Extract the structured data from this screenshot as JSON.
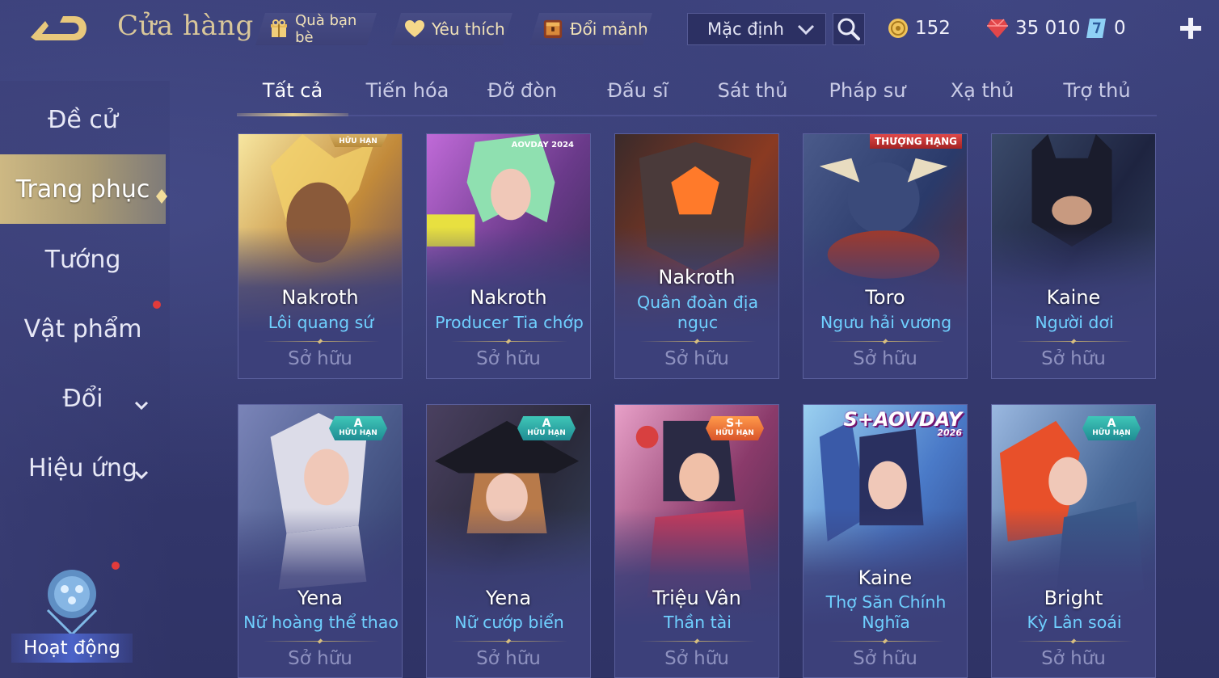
{
  "header": {
    "title": "Cửa hàng",
    "tabs": [
      {
        "label": "Quà bạn bè",
        "icon": "gift-icon"
      },
      {
        "label": "Yêu thích",
        "icon": "heart-icon"
      },
      {
        "label": "Đổi mảnh",
        "icon": "shard-chest-icon"
      }
    ],
    "sort": {
      "value": "Mặc định"
    },
    "currencies": [
      {
        "icon": "gold-coin-icon",
        "value": "152"
      },
      {
        "icon": "ruby-gem-icon",
        "value": "35 010"
      },
      {
        "icon": "voucher-icon",
        "value": "0"
      }
    ]
  },
  "sidebar": {
    "items": [
      {
        "label": "Đề cử"
      },
      {
        "label": "Trang phục"
      },
      {
        "label": "Tướng"
      },
      {
        "label": "Vật phẩm"
      },
      {
        "label": "Đổi"
      },
      {
        "label": "Hiệu ứng"
      }
    ],
    "activity_label": "Hoạt động"
  },
  "categories": [
    "Tất cả",
    "Tiến hóa",
    "Đỡ đòn",
    "Đấu sĩ",
    "Sát thủ",
    "Pháp sư",
    "Xạ thủ",
    "Trợ thủ"
  ],
  "cards": [
    {
      "hero": "Nakroth",
      "skin": "Lôi quang sứ",
      "status": "Sở hữu",
      "badge_title": "HỮU HẠN"
    },
    {
      "hero": "Nakroth",
      "skin": "Producer Tia chớp",
      "status": "Sở hữu",
      "badge_title": "AOVDAY 2024"
    },
    {
      "hero": "Nakroth",
      "skin": "Quân đoàn địa ngục",
      "status": "Sở hữu"
    },
    {
      "hero": "Toro",
      "skin": "Ngưu hải vương",
      "status": "Sở hữu",
      "ribbon": "THƯỢNG HẠNG"
    },
    {
      "hero": "Kaine",
      "skin": "Người dơi",
      "status": "Sở hữu"
    },
    {
      "hero": "Yena",
      "skin": "Nữ hoàng thể thao",
      "status": "Sở hữu",
      "grade": "A",
      "badge_title": "HỮU HẠN"
    },
    {
      "hero": "Yena",
      "skin": "Nữ cướp biển",
      "status": "Sở hữu",
      "grade": "A",
      "badge_title": "HỮU HẠN"
    },
    {
      "hero": "Triệu Vân",
      "skin": "Thần tài",
      "status": "Sở hữu",
      "grade": "S+",
      "badge_title": "HỮU HẠN"
    },
    {
      "hero": "Kaine",
      "skin": "Thợ Săn Chính Nghĩa",
      "status": "Sở hữu",
      "event": "S+AOVDAY",
      "event_year": "2026"
    },
    {
      "hero": "Bright",
      "skin": "Kỳ Lân soái",
      "status": "Sở hữu",
      "grade": "A",
      "badge_title": "HỮU HẠN"
    }
  ],
  "colors": {
    "background": "#363a70",
    "gold_text": "#d9c79a",
    "skin_text": "#6fd0ff",
    "badge_teal": "#3fc7b8",
    "badge_orange": "#ff9a4a",
    "notification": "#e23b3b"
  }
}
